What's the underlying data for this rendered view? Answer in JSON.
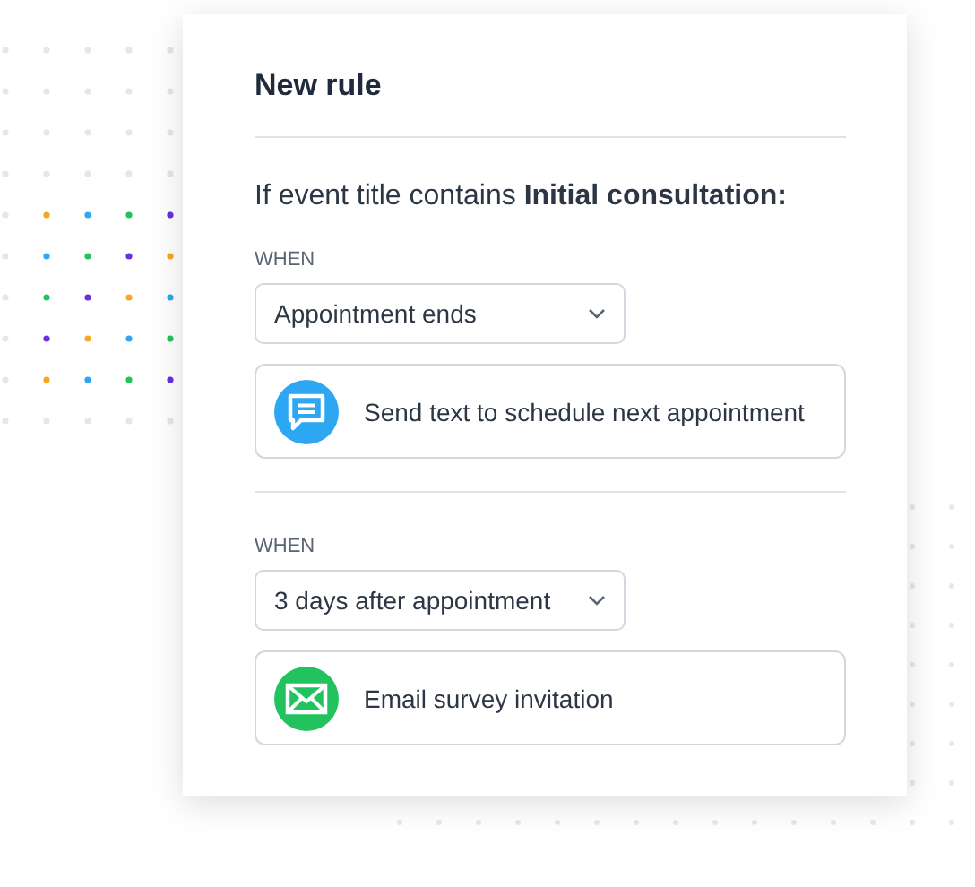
{
  "card": {
    "title": "New rule",
    "condition": "If event title contains **Initial consultation:**"
  },
  "steps": [
    {
      "label": "WHEN",
      "trigger": "Appointment ends",
      "action": {
        "kind": "text",
        "text": "Send text to schedule next appointment"
      }
    },
    {
      "label": "WHEN",
      "trigger": "3 days after appointment",
      "action": {
        "kind": "email",
        "text": "Email survey invitation"
      }
    }
  ]
}
